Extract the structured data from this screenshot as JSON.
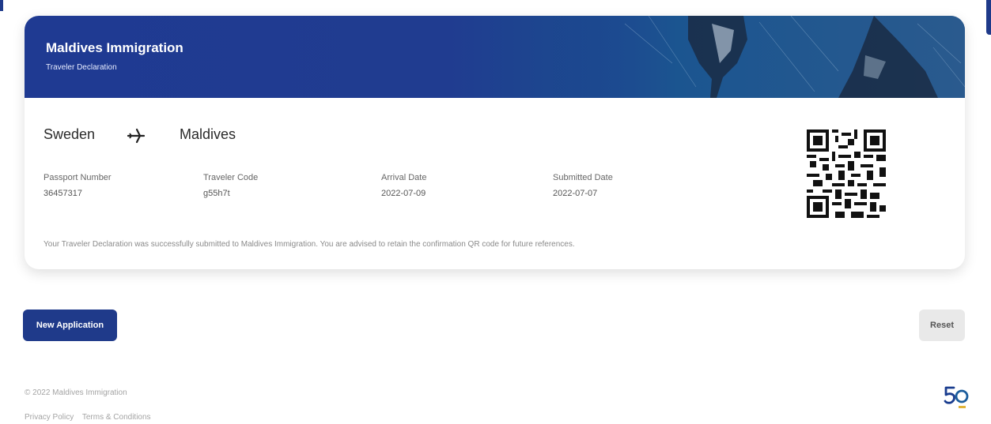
{
  "banner": {
    "title": "Maldives Immigration",
    "subtitle": "Traveler Declaration"
  },
  "route": {
    "origin": "Sweden",
    "destination": "Maldives",
    "icon": "airplane-icon"
  },
  "fields": [
    {
      "label": "Passport Number",
      "value": "36457317"
    },
    {
      "label": "Traveler Code",
      "value": "g55h7t"
    },
    {
      "label": "Arrival Date",
      "value": "2022-07-09"
    },
    {
      "label": "Submitted Date",
      "value": "2022-07-07"
    }
  ],
  "notice": "Your Traveler Declaration was successfully submitted to Maldives Immigration. You are advised to retain the confirmation QR code for future references.",
  "actions": {
    "new_application": "New Application",
    "reset": "Reset"
  },
  "footer": {
    "copyright": "© 2022 Maldives Immigration",
    "links": [
      "Privacy Policy",
      "Terms & Conditions"
    ]
  },
  "colors": {
    "brand": "#1f3a8a",
    "reset_bg": "#e9e9e9"
  },
  "icons": {
    "qr": "qr-code-icon",
    "logo": "fifty-anniversary-logo"
  }
}
